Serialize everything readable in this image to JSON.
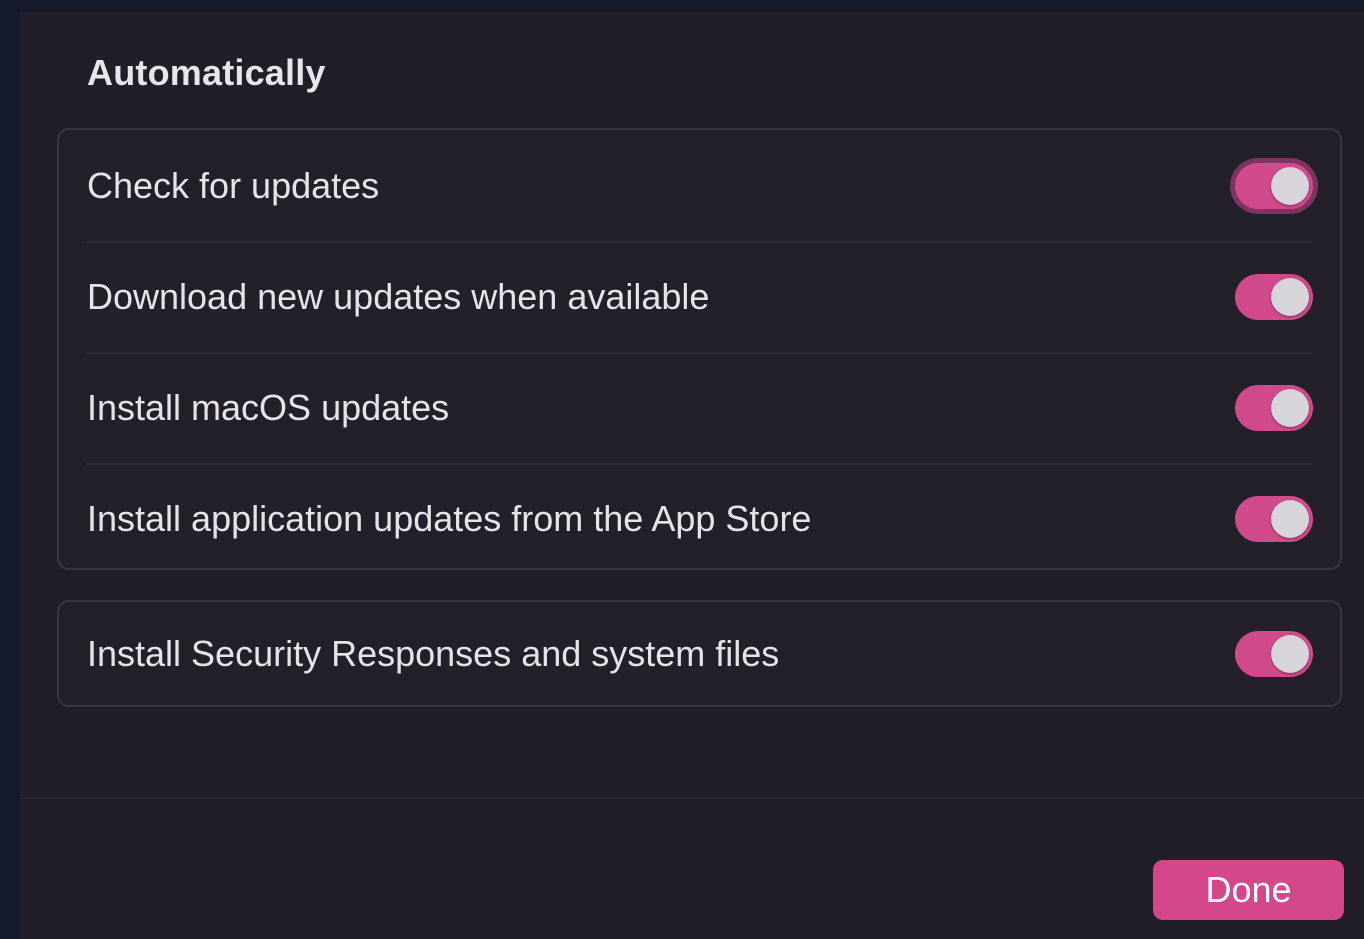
{
  "section": {
    "title": "Automatically"
  },
  "auto_options": [
    {
      "label": "Check for updates",
      "enabled": true,
      "focused": true
    },
    {
      "label": "Download new updates when available",
      "enabled": true
    },
    {
      "label": "Install macOS updates",
      "enabled": true
    },
    {
      "label": "Install application updates from the App Store",
      "enabled": true
    }
  ],
  "security_option": {
    "label": "Install Security Responses and system files",
    "enabled": true
  },
  "footer": {
    "done_label": "Done"
  },
  "colors": {
    "accent": "#d14a8b",
    "background": "#221e27"
  }
}
